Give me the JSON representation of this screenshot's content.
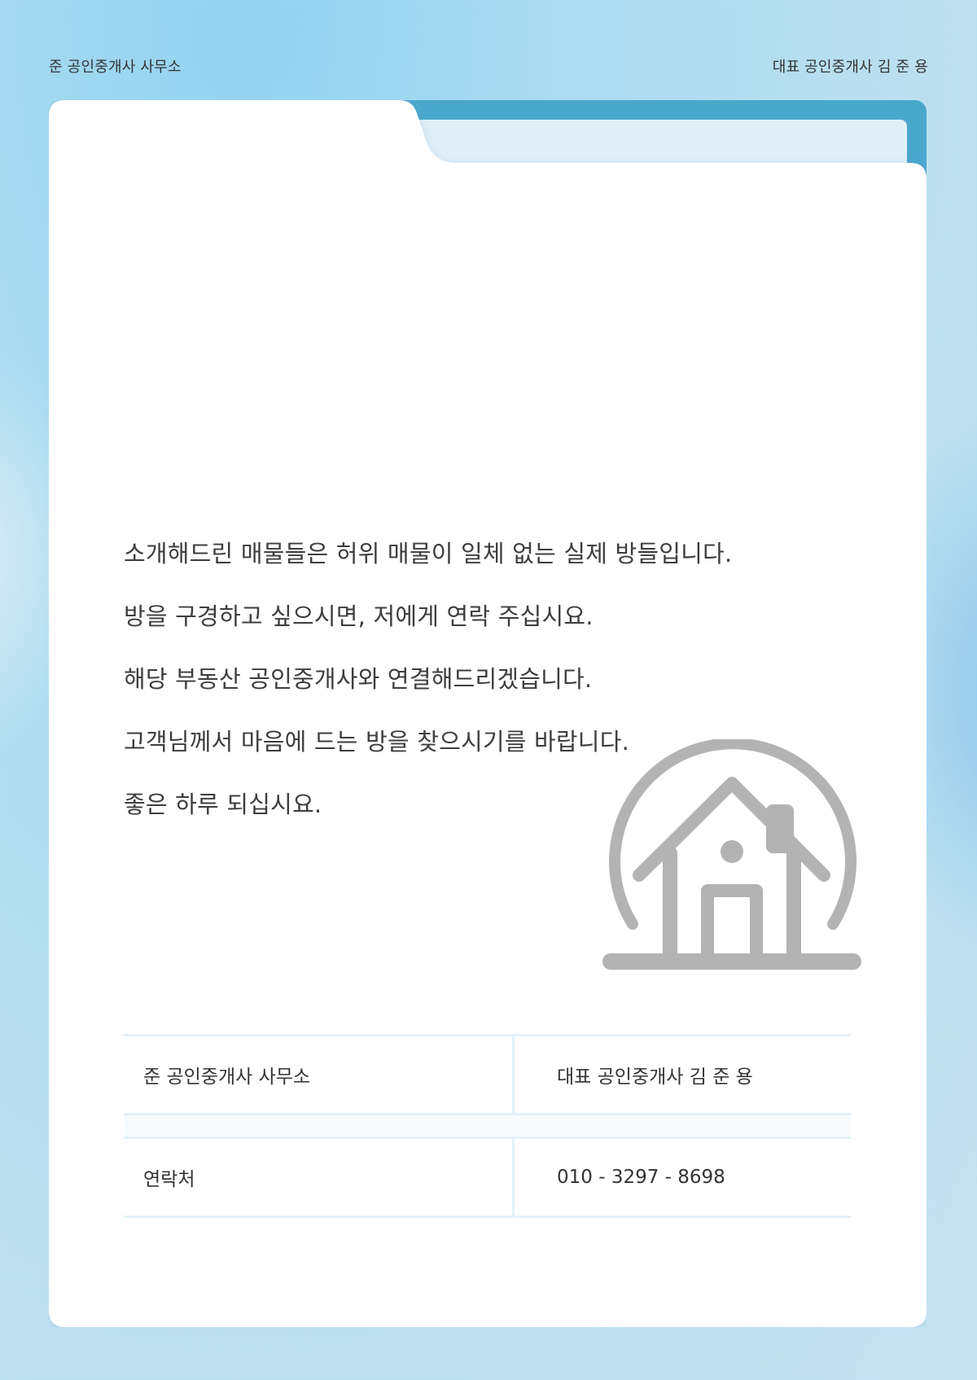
{
  "header": {
    "office_name": "준 공인중개사 사무소",
    "representative": "대표 공인중개사 김 준 용"
  },
  "message": {
    "lines": [
      "소개해드린 매물들은 허위 매물이 일체 없는 실제 방들입니다.",
      "방을 구경하고 싶으시면, 저에게 연락 주십시요.",
      "해당 부동산 공인중개사와 연결해드리겠습니다.",
      "고객님께서 마음에 드는 방을 찾으시기를 바랍니다.",
      "좋은 하루 되십시요."
    ]
  },
  "icon": {
    "name": "house-icon",
    "color": "#b3b3b3"
  },
  "info_table": {
    "rows": [
      {
        "label": "준 공인중개사 사무소",
        "value": "대표 공인중개사 김 준 용"
      },
      {
        "label": "연락처",
        "value": "010 - 3297 - 8698"
      }
    ]
  },
  "colors": {
    "background": "#a9dbf1",
    "folder_tab": "#4aa7cc",
    "folder_paper": "#e3eff8",
    "card": "#ffffff",
    "table_line": "#e4f1f9",
    "text": "#3a3a3a"
  }
}
